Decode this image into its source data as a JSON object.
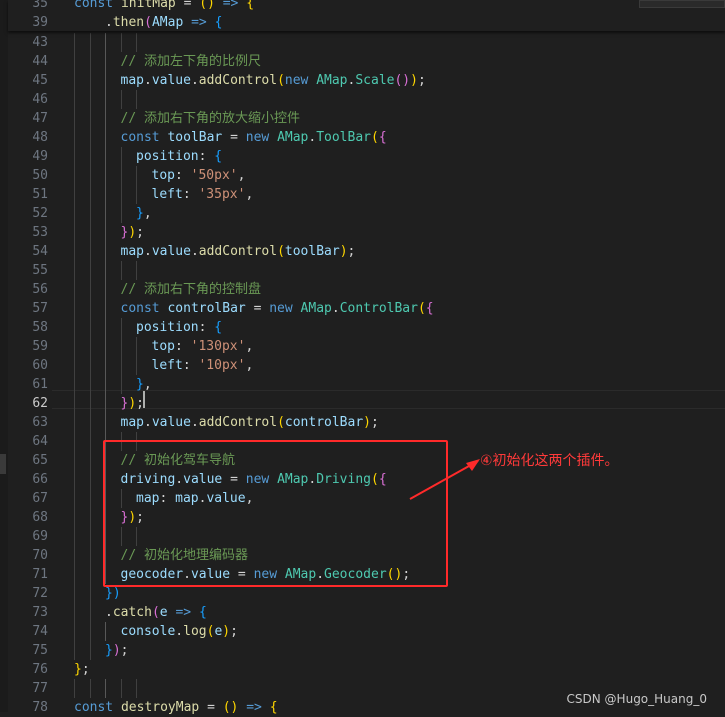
{
  "sticky": [
    {
      "num": "35",
      "indent": 0,
      "tokens": [
        [
          "const ",
          "kw"
        ],
        [
          "initMap",
          "fn"
        ],
        [
          " = ",
          "plain"
        ],
        [
          "()",
          "p1"
        ],
        [
          " => ",
          "kw"
        ],
        [
          "{",
          "p1"
        ]
      ]
    },
    {
      "num": "39",
      "indent": 2,
      "tokens": [
        [
          ".",
          "plain"
        ],
        [
          "then",
          "fn"
        ],
        [
          "(",
          "p2"
        ],
        [
          "AMap",
          "var"
        ],
        [
          " => ",
          "kw"
        ],
        [
          "{",
          "p3"
        ]
      ]
    }
  ],
  "lines": [
    {
      "num": "43",
      "indent": 3,
      "tokens": []
    },
    {
      "num": "44",
      "indent": 3,
      "tokens": [
        [
          "// 添加左下角的比例尺",
          "cmt"
        ]
      ]
    },
    {
      "num": "45",
      "indent": 3,
      "tokens": [
        [
          "map",
          "var"
        ],
        [
          ".",
          "plain"
        ],
        [
          "value",
          "var"
        ],
        [
          ".",
          "plain"
        ],
        [
          "addControl",
          "fn"
        ],
        [
          "(",
          "p1"
        ],
        [
          "new ",
          "kw"
        ],
        [
          "AMap",
          "cls"
        ],
        [
          ".",
          "plain"
        ],
        [
          "Scale",
          "cls"
        ],
        [
          "()",
          "p2"
        ],
        [
          ")",
          "p1"
        ],
        [
          ";",
          "plain"
        ]
      ]
    },
    {
      "num": "46",
      "indent": 3,
      "tokens": []
    },
    {
      "num": "47",
      "indent": 3,
      "tokens": [
        [
          "// 添加右下角的放大缩小控件",
          "cmt"
        ]
      ]
    },
    {
      "num": "48",
      "indent": 3,
      "tokens": [
        [
          "const ",
          "kw"
        ],
        [
          "toolBar",
          "var"
        ],
        [
          " = ",
          "plain"
        ],
        [
          "new ",
          "kw"
        ],
        [
          "AMap",
          "cls"
        ],
        [
          ".",
          "plain"
        ],
        [
          "ToolBar",
          "cls"
        ],
        [
          "(",
          "p1"
        ],
        [
          "{",
          "p2"
        ]
      ]
    },
    {
      "num": "49",
      "indent": 4,
      "tokens": [
        [
          "position",
          "var"
        ],
        [
          ": ",
          "plain"
        ],
        [
          "{",
          "p3"
        ]
      ]
    },
    {
      "num": "50",
      "indent": 5,
      "tokens": [
        [
          "top",
          "var"
        ],
        [
          ": ",
          "plain"
        ],
        [
          "'50px'",
          "str"
        ],
        [
          ",",
          "plain"
        ]
      ]
    },
    {
      "num": "51",
      "indent": 5,
      "tokens": [
        [
          "left",
          "var"
        ],
        [
          ": ",
          "plain"
        ],
        [
          "'35px'",
          "str"
        ],
        [
          ",",
          "plain"
        ]
      ]
    },
    {
      "num": "52",
      "indent": 4,
      "tokens": [
        [
          "}",
          "p3"
        ],
        [
          ",",
          "plain"
        ]
      ]
    },
    {
      "num": "53",
      "indent": 3,
      "tokens": [
        [
          "}",
          "p2"
        ],
        [
          ")",
          "p1"
        ],
        [
          ";",
          "plain"
        ]
      ]
    },
    {
      "num": "54",
      "indent": 3,
      "tokens": [
        [
          "map",
          "var"
        ],
        [
          ".",
          "plain"
        ],
        [
          "value",
          "var"
        ],
        [
          ".",
          "plain"
        ],
        [
          "addControl",
          "fn"
        ],
        [
          "(",
          "p1"
        ],
        [
          "toolBar",
          "var"
        ],
        [
          ")",
          "p1"
        ],
        [
          ";",
          "plain"
        ]
      ]
    },
    {
      "num": "55",
      "indent": 3,
      "tokens": []
    },
    {
      "num": "56",
      "indent": 3,
      "tokens": [
        [
          "// 添加右下角的控制盘",
          "cmt"
        ]
      ]
    },
    {
      "num": "57",
      "indent": 3,
      "tokens": [
        [
          "const ",
          "kw"
        ],
        [
          "controlBar",
          "var"
        ],
        [
          " = ",
          "plain"
        ],
        [
          "new ",
          "kw"
        ],
        [
          "AMap",
          "cls"
        ],
        [
          ".",
          "plain"
        ],
        [
          "ControlBar",
          "cls"
        ],
        [
          "(",
          "p1"
        ],
        [
          "{",
          "p2"
        ]
      ]
    },
    {
      "num": "58",
      "indent": 4,
      "tokens": [
        [
          "position",
          "var"
        ],
        [
          ": ",
          "plain"
        ],
        [
          "{",
          "p3"
        ]
      ]
    },
    {
      "num": "59",
      "indent": 5,
      "tokens": [
        [
          "top",
          "var"
        ],
        [
          ": ",
          "plain"
        ],
        [
          "'130px'",
          "str"
        ],
        [
          ",",
          "plain"
        ]
      ]
    },
    {
      "num": "60",
      "indent": 5,
      "tokens": [
        [
          "left",
          "var"
        ],
        [
          ": ",
          "plain"
        ],
        [
          "'10px'",
          "str"
        ],
        [
          ",",
          "plain"
        ]
      ]
    },
    {
      "num": "61",
      "indent": 4,
      "tokens": [
        [
          "}",
          "p3"
        ],
        [
          ",",
          "plain"
        ]
      ]
    },
    {
      "num": "62",
      "indent": 3,
      "tokens": [
        [
          "}",
          "p2"
        ],
        [
          ")",
          "p1"
        ],
        [
          ";",
          "plain"
        ]
      ],
      "active": true
    },
    {
      "num": "63",
      "indent": 3,
      "tokens": [
        [
          "map",
          "var"
        ],
        [
          ".",
          "plain"
        ],
        [
          "value",
          "var"
        ],
        [
          ".",
          "plain"
        ],
        [
          "addControl",
          "fn"
        ],
        [
          "(",
          "p1"
        ],
        [
          "controlBar",
          "var"
        ],
        [
          ")",
          "p1"
        ],
        [
          ";",
          "plain"
        ]
      ]
    },
    {
      "num": "64",
      "indent": 3,
      "tokens": []
    },
    {
      "num": "65",
      "indent": 3,
      "tokens": [
        [
          "// 初始化驾车导航",
          "cmt"
        ]
      ]
    },
    {
      "num": "66",
      "indent": 3,
      "tokens": [
        [
          "driving",
          "var"
        ],
        [
          ".",
          "plain"
        ],
        [
          "value",
          "var"
        ],
        [
          " = ",
          "plain"
        ],
        [
          "new ",
          "kw"
        ],
        [
          "AMap",
          "cls"
        ],
        [
          ".",
          "plain"
        ],
        [
          "Driving",
          "cls"
        ],
        [
          "(",
          "p1"
        ],
        [
          "{",
          "p2"
        ]
      ]
    },
    {
      "num": "67",
      "indent": 4,
      "tokens": [
        [
          "map",
          "var"
        ],
        [
          ": ",
          "plain"
        ],
        [
          "map",
          "var"
        ],
        [
          ".",
          "plain"
        ],
        [
          "value",
          "var"
        ],
        [
          ",",
          "plain"
        ]
      ]
    },
    {
      "num": "68",
      "indent": 3,
      "tokens": [
        [
          "}",
          "p2"
        ],
        [
          ")",
          "p1"
        ],
        [
          ";",
          "plain"
        ]
      ]
    },
    {
      "num": "69",
      "indent": 3,
      "tokens": []
    },
    {
      "num": "70",
      "indent": 3,
      "tokens": [
        [
          "// 初始化地理编码器",
          "cmt"
        ]
      ]
    },
    {
      "num": "71",
      "indent": 3,
      "tokens": [
        [
          "geocoder",
          "var"
        ],
        [
          ".",
          "plain"
        ],
        [
          "value",
          "var"
        ],
        [
          " = ",
          "plain"
        ],
        [
          "new ",
          "kw"
        ],
        [
          "AMap",
          "cls"
        ],
        [
          ".",
          "plain"
        ],
        [
          "Geocoder",
          "cls"
        ],
        [
          "()",
          "p1"
        ],
        [
          ";",
          "plain"
        ]
      ]
    },
    {
      "num": "72",
      "indent": 2,
      "tokens": [
        [
          "})",
          "p3"
        ]
      ]
    },
    {
      "num": "73",
      "indent": 2,
      "tokens": [
        [
          ".",
          "plain"
        ],
        [
          "catch",
          "fn"
        ],
        [
          "(",
          "p2"
        ],
        [
          "e",
          "var"
        ],
        [
          " => ",
          "kw"
        ],
        [
          "{",
          "p3"
        ]
      ]
    },
    {
      "num": "74",
      "indent": 3,
      "tokens": [
        [
          "console",
          "var"
        ],
        [
          ".",
          "plain"
        ],
        [
          "log",
          "fn"
        ],
        [
          "(",
          "p1"
        ],
        [
          "e",
          "var"
        ],
        [
          ")",
          "p1"
        ],
        [
          ";",
          "plain"
        ]
      ]
    },
    {
      "num": "75",
      "indent": 2,
      "tokens": [
        [
          "}",
          "p3"
        ],
        [
          ")",
          "p2"
        ],
        [
          ";",
          "plain"
        ]
      ]
    },
    {
      "num": "76",
      "indent": 0,
      "tokens": [
        [
          "}",
          "p1"
        ],
        [
          ";",
          "plain"
        ]
      ]
    },
    {
      "num": "77",
      "indent": 0,
      "tokens": []
    },
    {
      "num": "78",
      "indent": 0,
      "tokens": [
        [
          "const ",
          "kw"
        ],
        [
          "destroyMap",
          "fn"
        ],
        [
          " = ",
          "plain"
        ],
        [
          "()",
          "p1"
        ],
        [
          " => ",
          "kw"
        ],
        [
          "{",
          "p1"
        ]
      ]
    }
  ],
  "annotation": {
    "text": "④初始化这两个插件。",
    "color": "#ff2a2a"
  },
  "watermark": "CSDN @Hugo_Huang_0",
  "colors": {
    "keyword": "#569cd6",
    "class": "#4ec9b0",
    "function": "#dcdcaa",
    "variable": "#9cdcfe",
    "string": "#ce9178",
    "comment": "#6a9955",
    "background": "#1f1f1f"
  }
}
